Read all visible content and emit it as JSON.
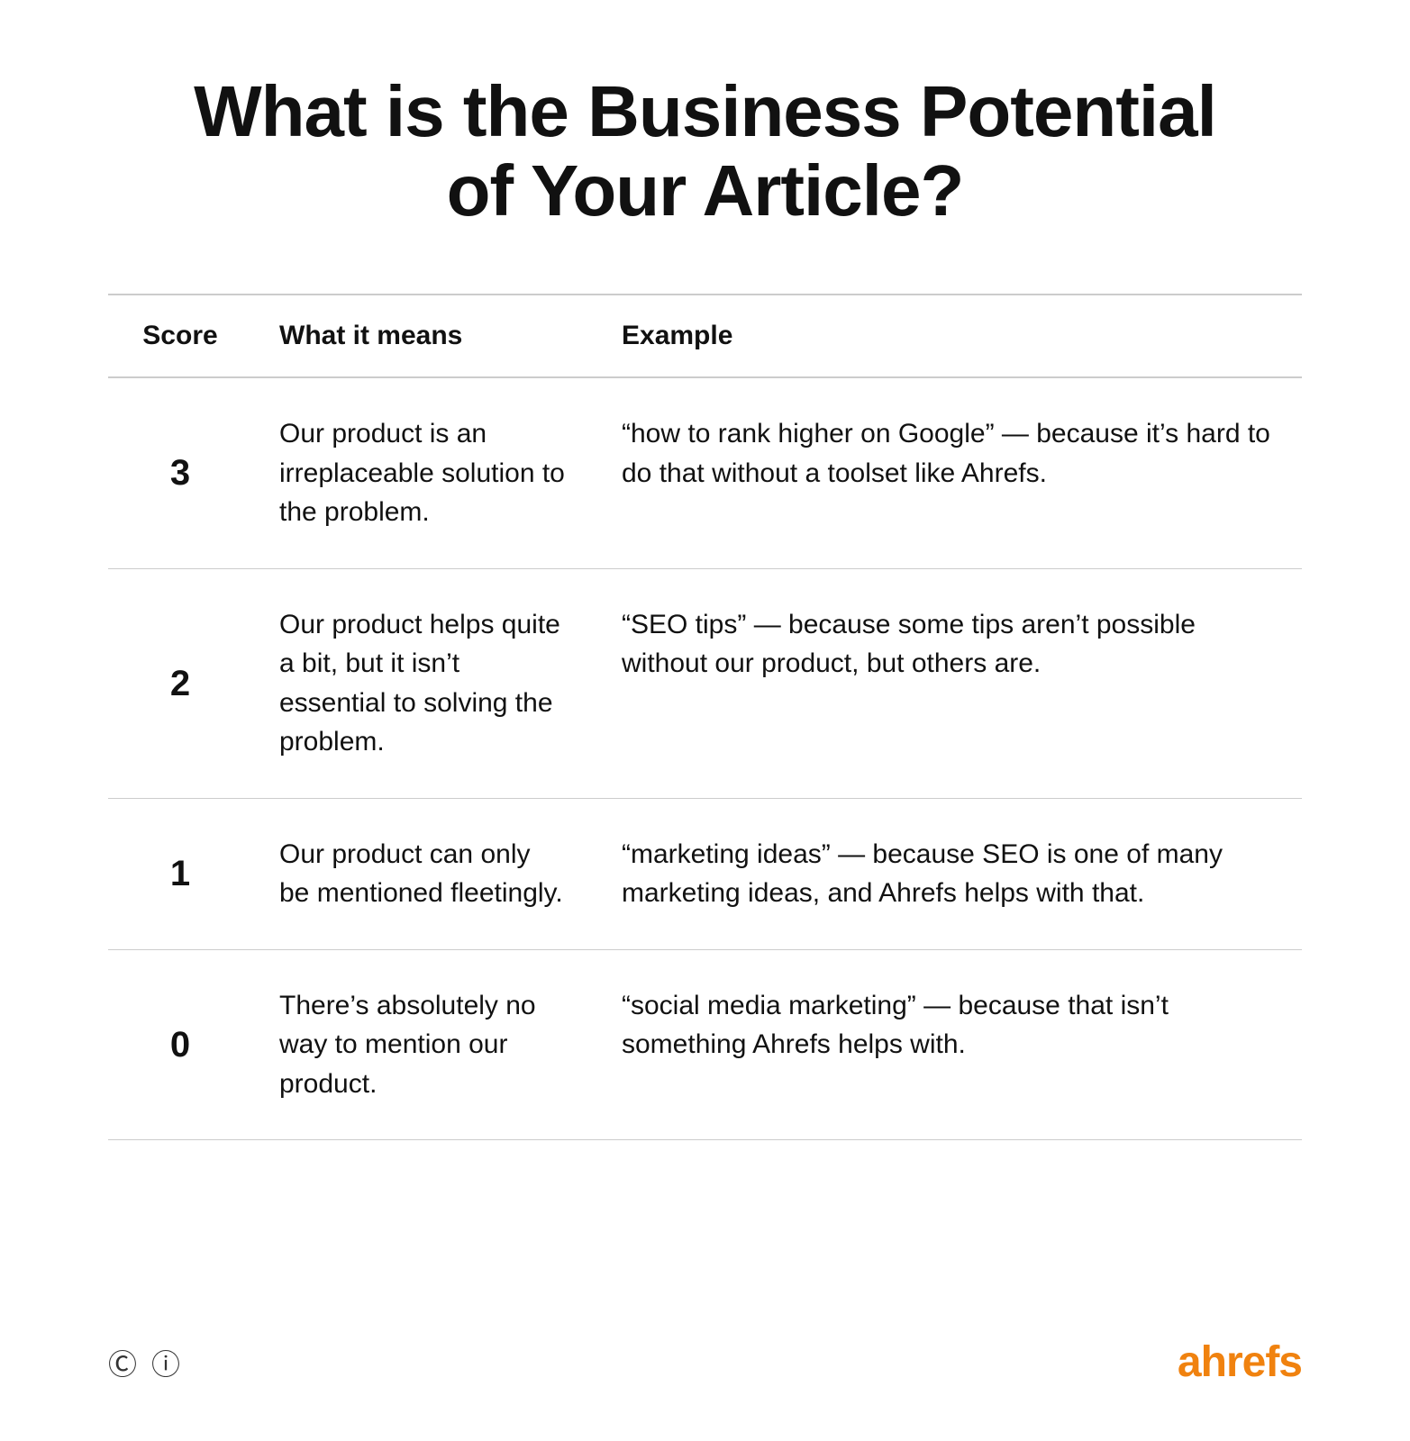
{
  "page": {
    "title_line1": "What is the Business Potential",
    "title_line2": "of Your Article?"
  },
  "table": {
    "headers": {
      "score": "Score",
      "what_it_means": "What it means",
      "example": "Example"
    },
    "rows": [
      {
        "score": "3",
        "what_it_means": "Our product is an irreplaceable solution to the problem.",
        "example": "“how to rank higher on Google” — because it’s hard to do that without a toolset like Ahrefs."
      },
      {
        "score": "2",
        "what_it_means": "Our product helps quite a bit, but it isn’t essential to solving the problem.",
        "example": "“SEO tips” — because some tips aren’t possible without our product, but others are."
      },
      {
        "score": "1",
        "what_it_means": "Our product can only be mentioned fleetingly.",
        "example": "“marketing ideas” — because SEO is one of many marketing ideas, and Ahrefs helps with that."
      },
      {
        "score": "0",
        "what_it_means": "There’s absolutely no way to mention our product.",
        "example": "“social media marketing” — because that isn’t something Ahrefs helps with."
      }
    ]
  },
  "footer": {
    "brand": "ahrefs",
    "cc_icon": "©",
    "info_icon": "ⓘ"
  }
}
